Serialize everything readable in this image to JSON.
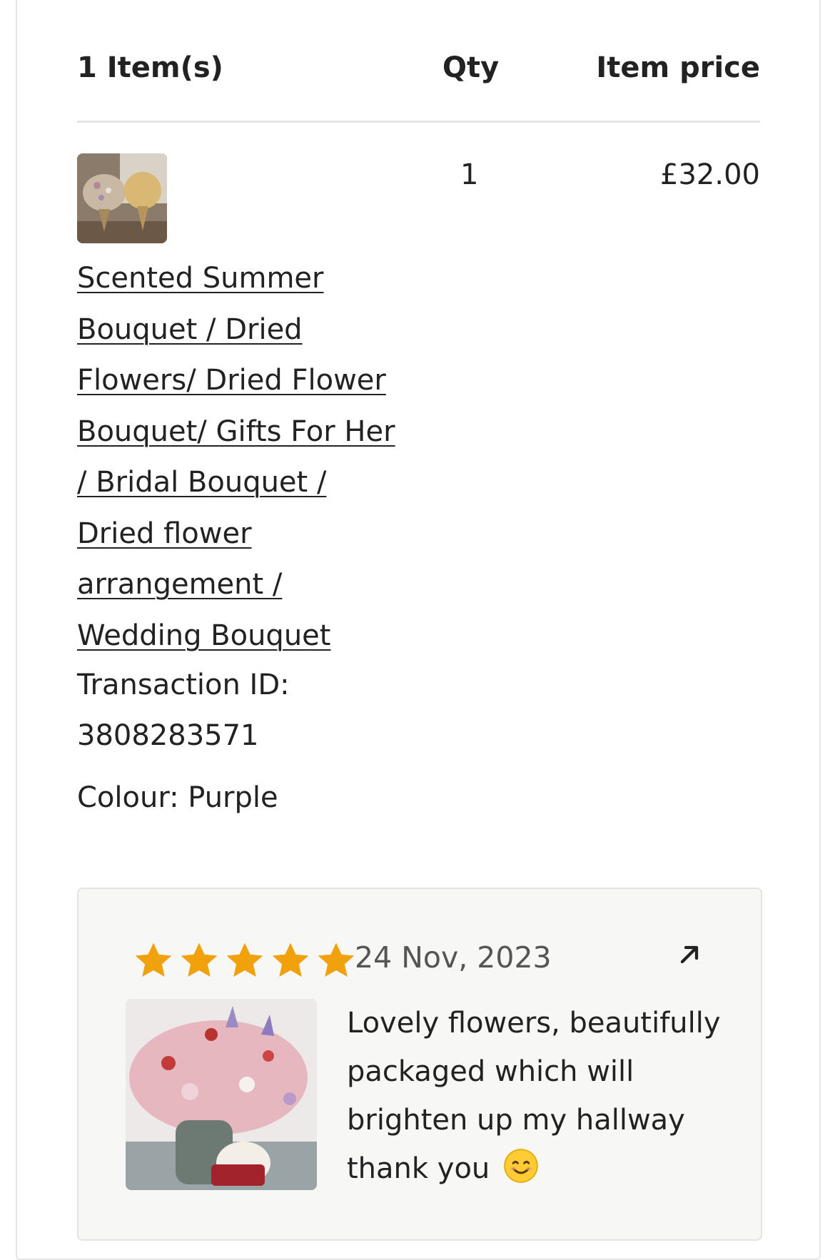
{
  "order": {
    "header": {
      "items_label": "1 Item(s)",
      "qty_label": "Qty",
      "price_label": "Item price"
    },
    "item": {
      "title": "Scented Summer Bouquet / Dried Flowers/ Dried Flower Bouquet/ Gifts For Her / Bridal Bouquet / Dried flower arrangement / Wedding Bouquet",
      "quantity": "1",
      "price": "£32.00",
      "transaction_label": "Transaction ID:",
      "transaction_id": "3808283571",
      "variation": "Colour: Purple"
    },
    "review": {
      "rating": 5,
      "max_rating": 5,
      "date": "24 Nov, 2023",
      "text": "Lovely flowers, beautifully packaged which will brighten up my hallway thank you",
      "star_color": "#F1A10B",
      "emoji": "smiling-face-emoji"
    }
  }
}
